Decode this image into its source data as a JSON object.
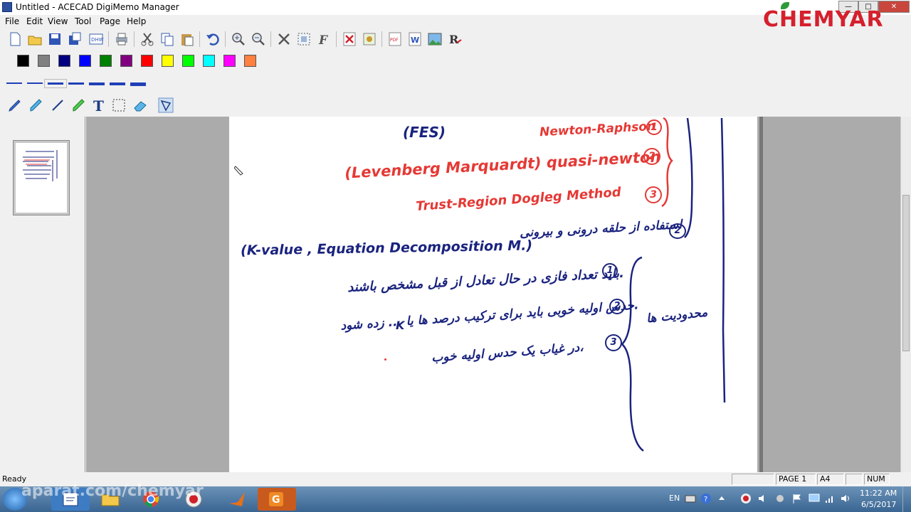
{
  "window": {
    "title": "Untitled - ACECAD DigiMemo Manager"
  },
  "logo": {
    "text": "CHEMYAR"
  },
  "menu": [
    "File",
    "Edit",
    "View",
    "Tool",
    "Page",
    "Help"
  ],
  "colors": {
    "palette": [
      "#000000",
      "#808080",
      "#000080",
      "#0000ff",
      "#008000",
      "#800080",
      "#ff0000",
      "#ffff00",
      "#00ff00",
      "#00ffff",
      "#ff00ff",
      "#ff8040"
    ],
    "ink_blue": "#1a237e",
    "ink_red": "#e53935"
  },
  "toolbar_icons": [
    "new-icon",
    "open-icon",
    "save-icon",
    "save-as-icon",
    "dhw-icon",
    "print-icon",
    "cut-icon",
    "copy-icon",
    "paste-icon",
    "undo-icon",
    "zoom-in-icon",
    "zoom-out-icon",
    "delete-icon",
    "select-icon",
    "font-icon",
    "close-doc-icon",
    "settings-icon",
    "pdf-icon",
    "word-icon",
    "image-icon",
    "recognize-icon"
  ],
  "tool_icons": [
    "pen-icon",
    "highlighter-icon",
    "line-icon",
    "green-pen-icon",
    "text-icon",
    "selection-icon",
    "eraser-icon",
    "lasso-icon"
  ],
  "note": {
    "line_fes": "(FES)",
    "line_newton": "Newton-Raphson",
    "line_levenberg": "(Levenberg Marquardt) quasi-newton",
    "line_trust": "Trust-Region Dogleg Method",
    "line_kvalue": "(K-value , Equation Decomposition M.)",
    "line_k": "K",
    "num1": "1",
    "num2": "2",
    "num3": "3"
  },
  "status": {
    "left": "Ready",
    "page": "PAGE 1",
    "size": "A4",
    "num": "NUM"
  },
  "taskbar": {
    "lang": "EN",
    "time": "11:22 AM",
    "date": "6/5/2017",
    "watermark": "aparat.com/chemyar"
  }
}
